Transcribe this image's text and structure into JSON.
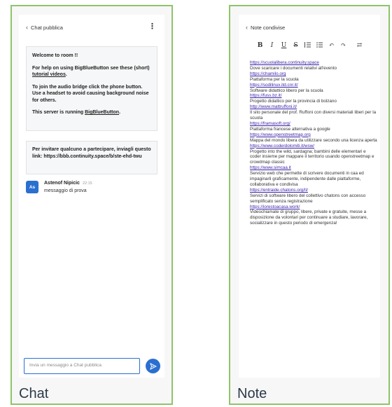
{
  "chat": {
    "caption": "Chat",
    "header_title": "Chat pubblica",
    "welcome": {
      "title": "Welcome to room !!",
      "help_pre": "For help on using BigBlueButton see these (short) ",
      "help_link": "tutorial videos",
      "help_post": ".",
      "audio": "To join the audio bridge click the phone button. Use a headset to avoid causing background noise for others.",
      "server_pre": "This server is running ",
      "server_link": "BigBlueButton",
      "server_post": "."
    },
    "invite": "Per invitare qualcuno a partecipare, inviagli questo link: https://bbb.continuity.space/b/ste-ehd-twu",
    "message": {
      "avatar": "As",
      "name": "Astenof Nipicic",
      "time": "22:15",
      "text": "messaggio di prova"
    },
    "composer_placeholder": "Invia un messaggio a Chat pubblica"
  },
  "notes": {
    "caption": "Note",
    "header_title": "Note condivise",
    "toolbar": [
      "B",
      "I",
      "U",
      "S",
      "ordered-list",
      "bullet-list",
      "undo",
      "redo",
      "swap"
    ],
    "lines": [
      {
        "t": "https://scuolalibera.continuity.space",
        "link": true
      },
      {
        "t": "Dove scaricare i documenti relativi all'evento",
        "link": false
      },
      {
        "t": "https://chamilo.org",
        "link": true
      },
      {
        "t": "Piattaforma per la scuola",
        "link": false
      },
      {
        "t": "https://sodilinux.itd.cnr.it/",
        "link": true
      },
      {
        "t": "Software didattico libero per la scuola",
        "link": false
      },
      {
        "t": "https://fuss.bz.it/",
        "link": true
      },
      {
        "t": "Progetto didattico per la provincia di bolzano",
        "link": false
      },
      {
        "t": "http://www.mattruffoni.it/",
        "link": true
      },
      {
        "t": " Il sito personale del prof. Ruffoni con diversi materiali liberi per la scuola",
        "link": false
      },
      {
        "t": "https://framasoft.org/",
        "link": true
      },
      {
        "t": "Piattaforma francese alternativa a google",
        "link": false
      },
      {
        "t": "https://www.openstreetmap.org",
        "link": true
      },
      {
        "t": "Mappa del mondo libera da utilizzare secondo una licenza aperta",
        "link": false
      },
      {
        "t": "https://www.coderdolomiti.it/wsw/",
        "link": true
      },
      {
        "t": "Progetto into the wild, sardagna; bambini delle elementari e coder insieme per mappare il territorio usando openstreetmap e crowdmap classic",
        "link": false
      },
      {
        "t": "https://www.simcaa.it",
        "link": true
      },
      {
        "t": "Servizio web che permette di scrivere documenti in caa ed impaginarli graficamente, indipendente dalle piattaforme, collaborativa e condivisa",
        "link": false
      },
      {
        "t": "https://entraide.chatons.org/it/",
        "link": true
      },
      {
        "t": "Servizi di software libero del collettivo chatons con accesso semplificato senza registrazione",
        "link": false
      },
      {
        "t": "https://iorestoacasa.work/",
        "link": true
      },
      {
        "t": "Videochiamate di gruppo, libere, private e gratuite, messe a disposizione da volontari per continuare a studiare, lavorare, socializzare in questo periodo di emergenza!",
        "link": false
      }
    ]
  }
}
